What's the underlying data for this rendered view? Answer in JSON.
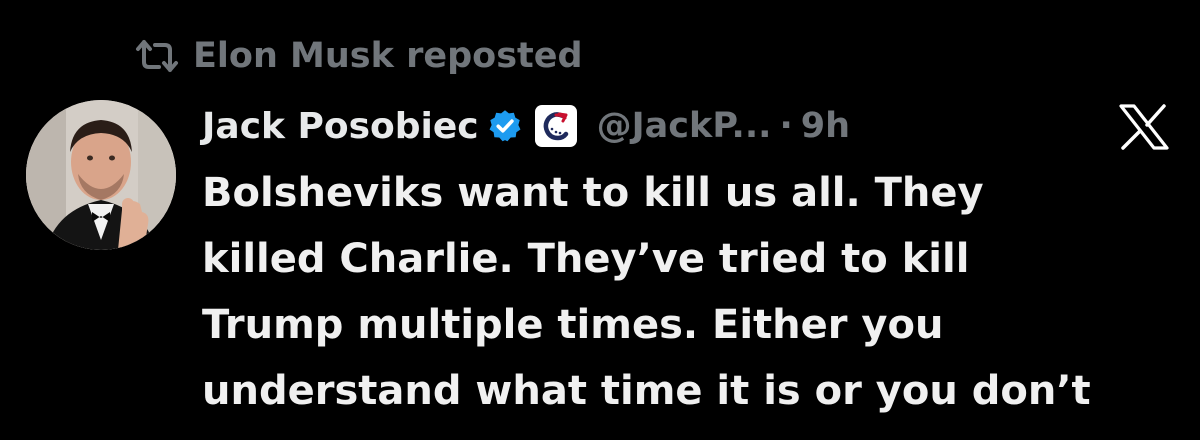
{
  "repost": {
    "icon": "repost-icon",
    "label": "Elon Musk reposted"
  },
  "author": {
    "avatar": "avatar",
    "display_name": "Jack Posobiec",
    "verified_icon": "verified-badge-icon",
    "verified_color": "#1d9bf0",
    "affiliate_icon": "affiliate-badge-icon",
    "handle": "@JackP...",
    "separator": "·",
    "time": "9h"
  },
  "platform_icon": "x-logo-icon",
  "post": {
    "lines": [
      "Bolsheviks want to kill us all. They",
      "killed Charlie. They’ve tried to kill",
      "Trump multiple times. Either you",
      "understand what time it is or you don’t"
    ]
  },
  "colors": {
    "background": "#000000",
    "primary_text": "#e7e9ea",
    "secondary_text": "#71767b"
  }
}
